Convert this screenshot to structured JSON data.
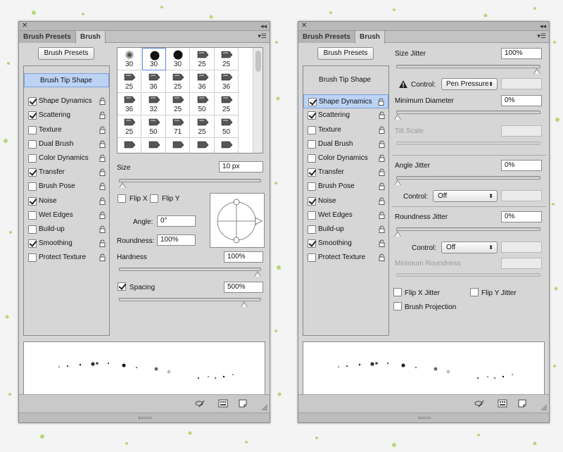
{
  "left_panel": {
    "tabs": [
      "Brush Presets",
      "Brush"
    ],
    "brush_presets_button": "Brush Presets",
    "sidebar": [
      {
        "label": "Brush Tip Shape",
        "checkbox": false,
        "checked": false,
        "selected": true
      },
      {
        "label": "Shape Dynamics",
        "checkbox": true,
        "checked": true,
        "selected": false
      },
      {
        "label": "Scattering",
        "checkbox": true,
        "checked": true,
        "selected": false
      },
      {
        "label": "Texture",
        "checkbox": true,
        "checked": false,
        "selected": false
      },
      {
        "label": "Dual Brush",
        "checkbox": true,
        "checked": false,
        "selected": false
      },
      {
        "label": "Color Dynamics",
        "checkbox": true,
        "checked": false,
        "selected": false
      },
      {
        "label": "Transfer",
        "checkbox": true,
        "checked": true,
        "selected": false
      },
      {
        "label": "Brush Pose",
        "checkbox": true,
        "checked": false,
        "selected": false
      },
      {
        "label": "Noise",
        "checkbox": true,
        "checked": true,
        "selected": false
      },
      {
        "label": "Wet Edges",
        "checkbox": true,
        "checked": false,
        "selected": false
      },
      {
        "label": "Build-up",
        "checkbox": true,
        "checked": false,
        "selected": false
      },
      {
        "label": "Smoothing",
        "checkbox": true,
        "checked": true,
        "selected": false
      },
      {
        "label": "Protect Texture",
        "checkbox": true,
        "checked": false,
        "selected": false
      }
    ],
    "tip_grid": [
      [
        "30",
        "30",
        "30",
        "25",
        "25"
      ],
      [
        "25",
        "36",
        "25",
        "36",
        "36"
      ],
      [
        "36",
        "32",
        "25",
        "50",
        "25"
      ],
      [
        "25",
        "50",
        "71",
        "25",
        "50"
      ]
    ],
    "size_label": "Size",
    "size_value": "10 px",
    "flip_x_label": "Flip X",
    "flip_y_label": "Flip Y",
    "angle_label": "Angle:",
    "angle_value": "0°",
    "roundness_label": "Roundness:",
    "roundness_value": "100%",
    "hardness_label": "Hardness",
    "hardness_value": "100%",
    "spacing_label": "Spacing",
    "spacing_value": "500%",
    "spacing_checked": true
  },
  "right_panel": {
    "tabs": [
      "Brush Presets",
      "Brush"
    ],
    "brush_presets_button": "Brush Presets",
    "sidebar": [
      {
        "label": "Brush Tip Shape",
        "checkbox": false,
        "checked": false,
        "selected": false
      },
      {
        "label": "Shape Dynamics",
        "checkbox": true,
        "checked": true,
        "selected": true
      },
      {
        "label": "Scattering",
        "checkbox": true,
        "checked": true,
        "selected": false
      },
      {
        "label": "Texture",
        "checkbox": true,
        "checked": false,
        "selected": false
      },
      {
        "label": "Dual Brush",
        "checkbox": true,
        "checked": false,
        "selected": false
      },
      {
        "label": "Color Dynamics",
        "checkbox": true,
        "checked": false,
        "selected": false
      },
      {
        "label": "Transfer",
        "checkbox": true,
        "checked": true,
        "selected": false
      },
      {
        "label": "Brush Pose",
        "checkbox": true,
        "checked": false,
        "selected": false
      },
      {
        "label": "Noise",
        "checkbox": true,
        "checked": true,
        "selected": false
      },
      {
        "label": "Wet Edges",
        "checkbox": true,
        "checked": false,
        "selected": false
      },
      {
        "label": "Build-up",
        "checkbox": true,
        "checked": false,
        "selected": false
      },
      {
        "label": "Smoothing",
        "checkbox": true,
        "checked": true,
        "selected": false
      },
      {
        "label": "Protect Texture",
        "checkbox": true,
        "checked": false,
        "selected": false
      }
    ],
    "size_jitter_label": "Size Jitter",
    "size_jitter_value": "100%",
    "control_label": "Control:",
    "control_value_1": "Pen Pressure",
    "min_diameter_label": "Minimum Diameter",
    "min_diameter_value": "0%",
    "tilt_scale_label": "Tilt Scale",
    "angle_jitter_label": "Angle Jitter",
    "angle_jitter_value": "0%",
    "control_value_2": "Off",
    "roundness_jitter_label": "Roundness Jitter",
    "roundness_jitter_value": "0%",
    "control_value_3": "Off",
    "min_roundness_label": "Minimum Roundness",
    "flip_x_jitter_label": "Flip X Jitter",
    "flip_y_jitter_label": "Flip Y Jitter",
    "brush_projection_label": "Brush Projection"
  },
  "levels": {
    "size_slider": 0.0,
    "hardness_slider": 1.0,
    "spacing_slider": 0.9,
    "size_jitter_slider": 1.0
  }
}
